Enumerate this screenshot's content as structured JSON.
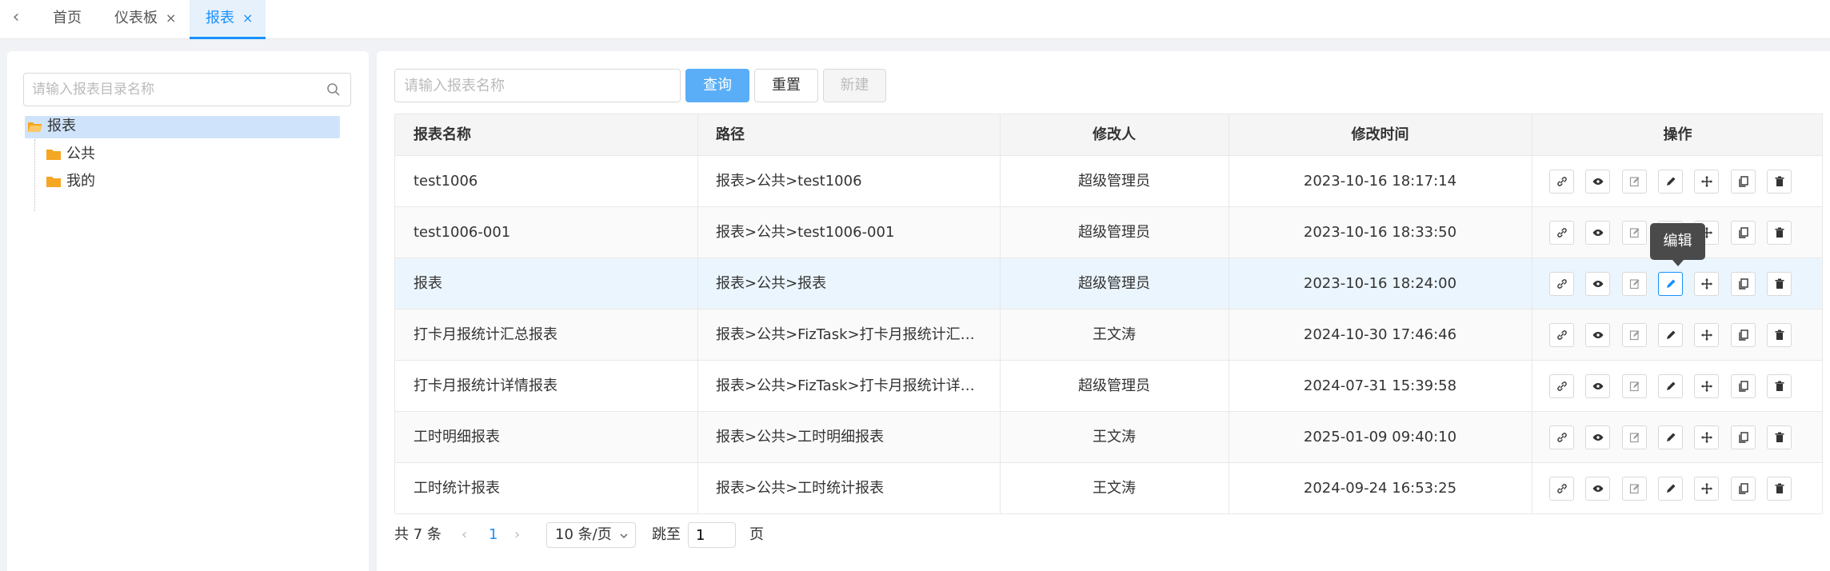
{
  "tabs": {
    "back": "‹",
    "items": [
      {
        "label": "首页",
        "closable": false
      },
      {
        "label": "仪表板",
        "closable": true
      },
      {
        "label": "报表",
        "closable": true,
        "active": true
      }
    ],
    "close_glyph": "×"
  },
  "tree": {
    "search_placeholder": "请输入报表目录名称",
    "root": "报表",
    "children": [
      "公共",
      "我的"
    ]
  },
  "toolbar": {
    "name_placeholder": "请输入报表名称",
    "query_label": "查询",
    "reset_label": "重置",
    "new_label": "新建"
  },
  "table": {
    "headers": [
      "报表名称",
      "路径",
      "修改人",
      "修改时间",
      "操作"
    ],
    "rows": [
      {
        "name": "test1006",
        "path": "报表>公共>test1006",
        "modifier": "超级管理员",
        "time": "2023-10-16 18:17:14"
      },
      {
        "name": "test1006-001",
        "path": "报表>公共>test1006-001",
        "modifier": "超级管理员",
        "time": "2023-10-16 18:33:50"
      },
      {
        "name": "报表",
        "path": "报表>公共>报表",
        "modifier": "超级管理员",
        "time": "2023-10-16 18:24:00"
      },
      {
        "name": "打卡月报统计汇总报表",
        "path": "报表>公共>FizTask>打卡月报统计汇…",
        "modifier": "王文涛",
        "time": "2024-10-30 17:46:46"
      },
      {
        "name": "打卡月报统计详情报表",
        "path": "报表>公共>FizTask>打卡月报统计详…",
        "modifier": "超级管理员",
        "time": "2024-07-31 15:39:58"
      },
      {
        "name": "工时明细报表",
        "path": "报表>公共>工时明细报表",
        "modifier": "王文涛",
        "time": "2025-01-09 09:40:10"
      },
      {
        "name": "工时统计报表",
        "path": "报表>公共>工时统计报表",
        "modifier": "王文涛",
        "time": "2024-09-24 16:53:25"
      }
    ],
    "action_icons": [
      "link-icon",
      "eye-icon",
      "edit-note-icon",
      "pencil-icon",
      "move-icon",
      "copy-icon",
      "trash-icon"
    ]
  },
  "tooltip": "编辑",
  "pagination": {
    "total": "共 7 条",
    "prev": "‹",
    "page": "1",
    "next": "›",
    "page_size": "10 条/页",
    "jump_label": "跳至",
    "jump_value": "1",
    "page_unit": "页"
  },
  "colors": {
    "primary": "#1890ff",
    "primary_light": "#5aaef7",
    "hover_row": "#ebf5fd"
  }
}
